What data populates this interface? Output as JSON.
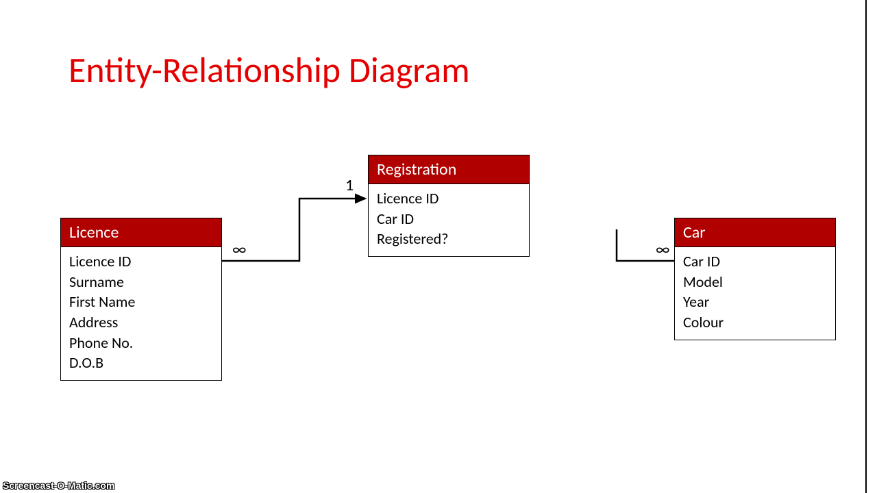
{
  "title": "Entity-Relationship Diagram",
  "entities": {
    "licence": {
      "name": "Licence",
      "fields": [
        "Licence ID",
        "Surname",
        "First Name",
        "Address",
        "Phone No.",
        "D.O.B"
      ]
    },
    "registration": {
      "name": "Registration",
      "fields": [
        "Licence ID",
        "Car ID",
        "Registered?"
      ]
    },
    "car": {
      "name": "Car",
      "fields": [
        "Car ID",
        "Model",
        "Year",
        "Colour"
      ]
    }
  },
  "cardinalities": {
    "licence_side": "∞",
    "registration_side": "1",
    "car_side": "∞"
  },
  "watermark": "Screencast-O-Matic.com"
}
